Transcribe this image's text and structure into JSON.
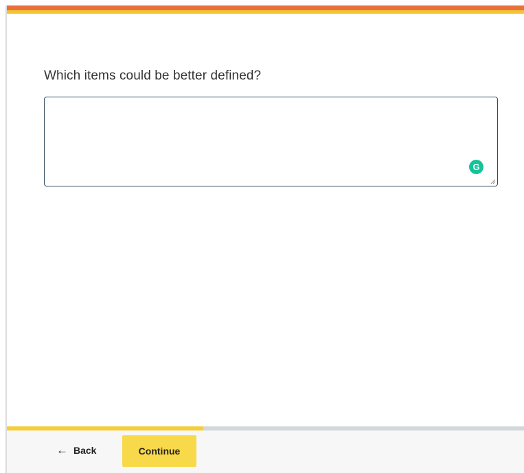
{
  "header": {
    "accent_color": "#e8703a",
    "secondary_color": "#f5c433"
  },
  "question": {
    "text": "Which items could be better defined?"
  },
  "answer": {
    "value": "",
    "placeholder": "",
    "grammarly_icon": "grammarly-icon",
    "grammarly_letter": "G"
  },
  "footer": {
    "progress_fraction": 0.38,
    "back_label": "Back",
    "back_icon": "arrow-left-icon",
    "back_arrow_glyph": "←",
    "continue_label": "Continue",
    "continue_color": "#f8d94a"
  }
}
